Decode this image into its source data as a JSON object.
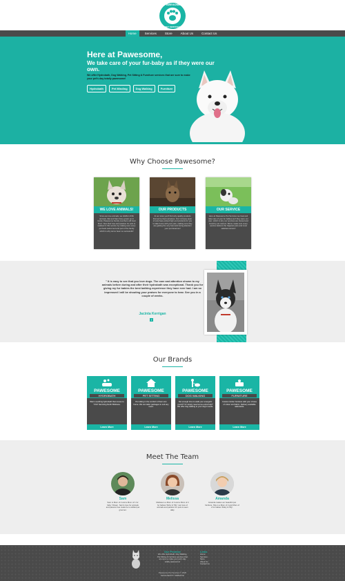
{
  "logo": {
    "top_text": "PAWESOME",
    "bottom_text": "PET SERVICES"
  },
  "nav": [
    "Home",
    "Services",
    "Store",
    "About Us",
    "Contact Us"
  ],
  "hero": {
    "title": "Here at Pawesome,",
    "subtitle": "We take care of your fur-baby as if they were our own.",
    "text": "We offer Hydrobath, Dog Walking, Pet Sitting & Furniture services that are sure to make your pet's day totally pawesome!",
    "buttons": [
      "Hydrobath",
      "Pet Minding",
      "Dog Walking",
      "Furniture"
    ]
  },
  "why": {
    "title": "Why Choose Pawesome?",
    "cards": [
      {
        "label": "WE LOVE ANIMALS!",
        "text": "Since we love animals, we HAVE LOVE animals. Mel and Sam have grown up in family. Pawesome Family members will treat them. Now their love and passion for pets is realised in this service by making sure every pet feels welcomed and part of the family which is why we've been so successful!"
      },
      {
        "label": "OUR PRODUCTS",
        "text": "At our store you'll find only quality products that we've tried ourselves. Our in-house team of vets have picked high-end products for you to take home with your pets, making sure they are getting the very best and loving attention your pet deserves!"
      },
      {
        "label": "OUR SERVICE",
        "text": "Here at Pawesome Pet Services we treat and take care of your fur babies as if they were our own, which is why our services are trusted and loved by pet owners. We've made sure every service delivers the happiest pets and most satisfied owners!"
      }
    ]
  },
  "testimonial": {
    "quote": "\" It is easy to see that you love dogs. The care and attention shown to my animals before during and after their hydrobath was exceptional. Thank you for giving my fur babies the best bathing experience they have ever had. I am so impressed I will be shouting your praises for everyone to hear. See you in a couple of weeks.",
    "author": "Jacinta Kerrigan",
    "fb": "f"
  },
  "brands": {
    "title": "Our Brands",
    "items": [
      {
        "name": "PAWESOME",
        "sub": "HYDROBATH",
        "text": "Warm soothing hydrobath that comes to YOU! Servicing North Brisbane.",
        "more": "Learn More"
      },
      {
        "name": "PAWESOME",
        "sub": "PET SITTING",
        "text": "Pet sitting in the comfort of their own home. We can tailor packages to suit any need.",
        "more": "Learn More"
      },
      {
        "name": "PAWESOME",
        "sub": "DOG WALKING",
        "text": "Not enough time to walk your energetic pooch? Or simply need some extra help? We offer dog walking to your dog's needs.",
        "more": "Learn More"
      },
      {
        "name": "PAWESOME",
        "sub": "FURNITURE",
        "text": "Custom timber furniture with your choice of colour and fabric. Delivery available nationwide.",
        "more": "Learn More"
      }
    ]
  },
  "team": {
    "title": "Meet The Team",
    "members": [
      {
        "name": "Sam",
        "text": "Sam is Mum of 2 and a Mum of 1 fur baby 'Chase'. Sam's love for animals and passion has made her a skilled pet groomer."
      },
      {
        "name": "Melissa",
        "text": "Melissa is a Mum of 4 and a Mum of 2 fur babies 'Ruby & Tilly'. Her love of animals and passion for pets is seen daily."
      },
      {
        "name": "Amanda",
        "text": "Amanda makes our beautiful pet furniture. She is a Mum of 4 and Mum of 2 fur babies 'Ruby & Tilly'."
      }
    ]
  },
  "footer": {
    "promise_title": "Our Promise",
    "promise_text": "We offer Hydrobath, Dog Walking, Pet Sitting & Furniture services that are sure to make your pet's day totally pawesome!",
    "links_title": "Links",
    "links": [
      "Home",
      "Services",
      "Store",
      "About Us",
      "Contact Us"
    ],
    "copyright": "Pawesome Pet Services © 2020",
    "credit": "DESIGNED BY WEBMATE"
  }
}
